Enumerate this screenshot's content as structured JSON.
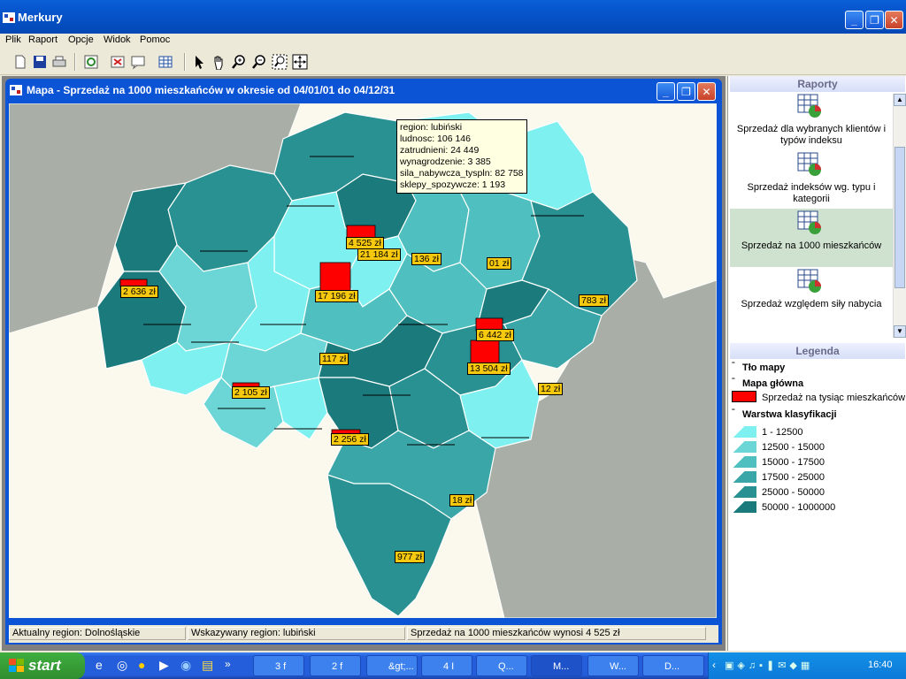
{
  "app": {
    "title": "Merkury"
  },
  "menu": [
    "Plik",
    "Raport",
    "Opcje",
    "Widok",
    "Pomoc"
  ],
  "child": {
    "title": "Mapa - Sprzedaż na 1000 mieszkańców w okresie od 04/01/01  do 04/12/31"
  },
  "tooltip": {
    "lines": [
      "region: lubiński",
      "ludnosc: 106 146",
      "zatrudnieni: 24 449",
      "wynagrodzenie: 3 385",
      "sila_nabywcza_tyspln: 82 758",
      "sklepy_spozywcze: 1 193"
    ]
  },
  "map_labels": [
    "4 525 zł",
    "21 184 zł",
    "136 zł",
    "01 zł",
    "17 196 zł",
    "2 636 zł",
    "783 zł",
    "6 442 zł",
    "13 504 zł",
    "117 zł",
    "2 105 zł",
    "12 zł",
    "2 256 zł",
    "18 zł",
    "977 zł"
  ],
  "status": {
    "current": "Aktualny region: Dolnośląskie",
    "pointed": "Wskazywany region: lubiński",
    "value": "Sprzedaż na 1000 mieszkańców wynosi 4 525 zł"
  },
  "reports": {
    "header": "Raporty",
    "items": [
      "Sprzedaż dla wybranych klientów i typów indeksu",
      "Sprzedaż indeksów wg. typu i kategorii",
      "Sprzedaż na 1000 mieszkańców",
      "Sprzedaż względem siły nabycia"
    ]
  },
  "legend": {
    "header": "Legenda",
    "bg": "Tło mapy",
    "main": "Mapa główna",
    "main_item": "Sprzedaż na tysiąc mieszkańców",
    "class": "Warstwa klasyfikacji",
    "ranges": [
      "1 - 12500",
      "12500 - 15000",
      "15000 - 17500",
      "17500 - 25000",
      "25000 - 50000",
      "50000 - 1000000"
    ],
    "colors": [
      "#7ff0f0",
      "#6cd6d6",
      "#50bfc0",
      "#3aa6a8",
      "#2a9193",
      "#1a7a7c"
    ]
  },
  "taskbar": {
    "start": "start",
    "tasks": [
      "3 f",
      "2 f",
      "&gt;...",
      "4 I",
      "Q...",
      "M...",
      "W...",
      "D..."
    ],
    "clock": "16:40"
  }
}
